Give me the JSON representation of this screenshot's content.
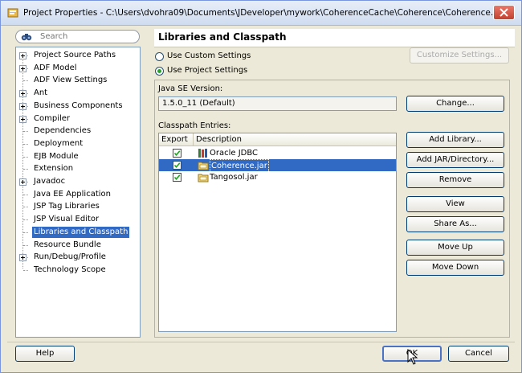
{
  "window": {
    "title": "Project Properties - C:\\Users\\dvohra09\\Documents\\JDeveloper\\mywork\\CoherenceCache\\Coherence\\Coherence.jpr"
  },
  "search": {
    "placeholder": "Search"
  },
  "nav": {
    "items": [
      {
        "label": "Project Source Paths",
        "expandable": true
      },
      {
        "label": "ADF Model",
        "expandable": true
      },
      {
        "label": "ADF View Settings",
        "expandable": false
      },
      {
        "label": "Ant",
        "expandable": true
      },
      {
        "label": "Business Components",
        "expandable": true
      },
      {
        "label": "Compiler",
        "expandable": true
      },
      {
        "label": "Dependencies",
        "expandable": false
      },
      {
        "label": "Deployment",
        "expandable": false
      },
      {
        "label": "EJB Module",
        "expandable": false
      },
      {
        "label": "Extension",
        "expandable": false
      },
      {
        "label": "Javadoc",
        "expandable": true
      },
      {
        "label": "Java EE Application",
        "expandable": false
      },
      {
        "label": "JSP Tag Libraries",
        "expandable": false
      },
      {
        "label": "JSP Visual Editor",
        "expandable": false
      },
      {
        "label": "Libraries and Classpath",
        "expandable": false,
        "selected": true
      },
      {
        "label": "Resource Bundle",
        "expandable": false
      },
      {
        "label": "Run/Debug/Profile",
        "expandable": true
      },
      {
        "label": "Technology Scope",
        "expandable": false
      }
    ]
  },
  "panel": {
    "title": "Libraries and Classpath",
    "use_custom": "Use Custom Settings",
    "use_project": "Use Project Settings",
    "customize_btn": "Customize Settings...",
    "java_se_label": "Java SE Version:",
    "java_se_value": "1.5.0_11 (Default)",
    "change_btn": "Change...",
    "classpath_label": "Classpath Entries:",
    "col_export": "Export",
    "col_description": "Description",
    "entries": [
      {
        "name": "Oracle JDBC",
        "exported": true,
        "icon": "library-books-icon"
      },
      {
        "name": "Coherence.jar",
        "exported": true,
        "icon": "jar-folder-icon",
        "selected": true
      },
      {
        "name": "Tangosol.jar",
        "exported": true,
        "icon": "jar-folder-icon"
      }
    ],
    "add_library_btn": "Add Library...",
    "add_jar_btn": "Add JAR/Directory...",
    "remove_btn": "Remove",
    "view_btn": "View",
    "share_as_btn": "Share As...",
    "move_up_btn": "Move Up",
    "move_down_btn": "Move Down"
  },
  "footer": {
    "help_btn": "Help",
    "ok_btn": "OK",
    "cancel_btn": "Cancel"
  },
  "colors": {
    "selection": "#316ac5",
    "dialog_bg": "#ece9d8",
    "radio_dot": "#2aa12a",
    "close_red": "#c1412f"
  }
}
